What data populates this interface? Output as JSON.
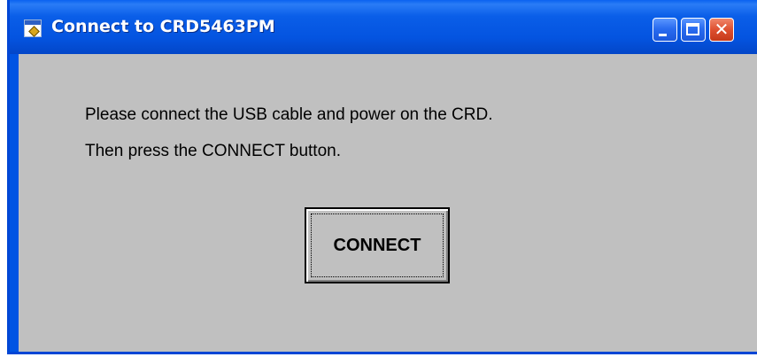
{
  "window": {
    "title": "Connect to CRD5463PM"
  },
  "titlebar": {
    "icons": [
      "app-icon",
      "minimize-icon",
      "maximize-icon",
      "close-icon"
    ],
    "close_glyph": "✕"
  },
  "message": {
    "line1": "Please connect the USB cable and power on the CRD.",
    "line2": "Then press the CONNECT button."
  },
  "buttons": {
    "connect_label": "CONNECT"
  },
  "colors": {
    "titlebar": "#0054e3",
    "client_background": "#c0c0c0",
    "close_button": "#de5030"
  }
}
